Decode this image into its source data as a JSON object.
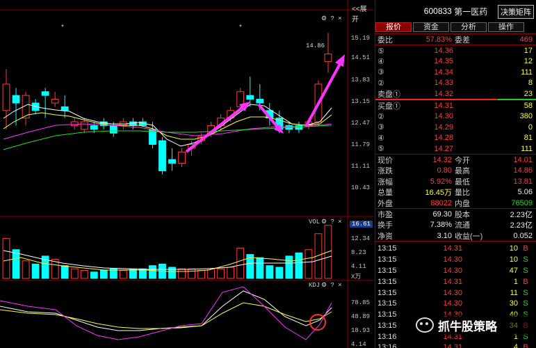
{
  "chart": {
    "toggle_label": "<<展开",
    "price_axis": [
      "15.19",
      "14.51",
      "13.83",
      "13.15",
      "12.47",
      "11.79",
      "11.11",
      "10.43"
    ],
    "high_marker": "14.86",
    "vol_label": "VOL",
    "vol_current": "16.61",
    "vol_axis": [
      "12.34",
      "8.23",
      "4.11"
    ],
    "vol_unit": "X万",
    "kdj_label": "KDJ",
    "kdj_axis": [
      "78.85",
      "48.89",
      "18.93"
    ],
    "kdj_current": "4.14",
    "colors": {
      "up": "#ff3b3b",
      "down": "#00ffff",
      "arrow": "#ff33ff",
      "circle": "#ff3030"
    }
  },
  "chart_data": {
    "type": "candlestick",
    "price_ylim": [
      10.1,
      15.4
    ],
    "candles": [
      [
        12.8,
        13.5,
        12.3,
        13.9
      ],
      [
        13.2,
        13.0,
        12.4,
        13.4
      ],
      [
        12.6,
        13.2,
        12.4,
        13.3
      ],
      [
        13.0,
        12.8,
        12.7,
        13.1
      ],
      [
        13.3,
        13.2,
        12.6,
        13.4
      ],
      [
        13.0,
        13.1,
        12.9,
        13.3
      ],
      [
        12.9,
        12.8,
        12.6,
        13.2
      ],
      [
        12.4,
        12.5,
        12.3,
        12.6
      ],
      [
        12.3,
        12.5,
        12.2,
        12.6
      ],
      [
        12.4,
        12.3,
        12.2,
        12.5
      ],
      [
        12.5,
        12.4,
        12.3,
        12.6
      ],
      [
        12.4,
        12.2,
        12.1,
        12.5
      ],
      [
        12.4,
        12.5,
        12.3,
        12.6
      ],
      [
        12.5,
        12.4,
        12.3,
        12.6
      ],
      [
        12.5,
        12.4,
        12.4,
        12.6
      ],
      [
        12.3,
        11.9,
        11.8,
        12.5
      ],
      [
        12.0,
        11.2,
        11.1,
        12.1
      ],
      [
        11.5,
        11.4,
        11.2,
        11.8
      ],
      [
        11.4,
        11.7,
        11.3,
        11.8
      ],
      [
        11.8,
        11.9,
        11.6,
        12.0
      ],
      [
        12.0,
        12.1,
        11.9,
        12.2
      ],
      [
        12.2,
        12.4,
        12.1,
        12.5
      ],
      [
        12.4,
        12.6,
        12.3,
        12.7
      ],
      [
        12.6,
        12.8,
        12.5,
        12.9
      ],
      [
        12.9,
        13.3,
        12.8,
        13.4
      ],
      [
        13.2,
        13.1,
        12.9,
        13.7
      ],
      [
        13.1,
        13.0,
        12.8,
        13.5
      ],
      [
        12.8,
        12.6,
        12.4,
        13.0
      ],
      [
        12.6,
        12.3,
        12.2,
        12.8
      ],
      [
        12.4,
        12.3,
        12.2,
        12.5
      ],
      [
        12.4,
        12.3,
        12.2,
        12.5
      ],
      [
        12.4,
        12.5,
        12.3,
        12.6
      ],
      [
        12.5,
        13.5,
        12.4,
        13.6
      ],
      [
        14.1,
        14.3,
        13.8,
        14.86
      ]
    ],
    "volumes": [
      12.5,
      9.0,
      5.5,
      4.5,
      7.0,
      6.0,
      4.0,
      3.0,
      2.5,
      2.0,
      2.5,
      3.0,
      2.5,
      3.0,
      3.0,
      4.0,
      4.5,
      3.5,
      3.0,
      3.0,
      2.5,
      3.0,
      3.0,
      3.5,
      9.5,
      7.5,
      6.5,
      4.0,
      3.5,
      7.0,
      8.0,
      9.0,
      14.0,
      16.61
    ],
    "vol_ylim": [
      0,
      17
    ]
  },
  "panel": {
    "code": "600833",
    "name": "第一医药",
    "decision_button": "决策矩阵",
    "tabs": [
      "报价",
      "资金",
      "分析",
      "操作"
    ],
    "weibi_label": "委比",
    "weibi_value": "57.83%",
    "weicha_label": "委差",
    "weicha_value": "469",
    "asks": [
      {
        "label": "⑤",
        "price": "14.36",
        "vol": "17"
      },
      {
        "label": "④",
        "price": "14.35",
        "vol": "12"
      },
      {
        "label": "③",
        "price": "14.34",
        "vol": "111"
      },
      {
        "label": "②",
        "price": "14.33",
        "vol": "8"
      },
      {
        "label": "卖盘①",
        "price": "14.32",
        "vol": "23"
      }
    ],
    "bids": [
      {
        "label": "买盘①",
        "price": "14.31",
        "vol": "58"
      },
      {
        "label": "②",
        "price": "14.30",
        "vol": "380"
      },
      {
        "label": "③",
        "price": "14.29",
        "vol": "0"
      },
      {
        "label": "④",
        "price": "14.28",
        "vol": "81"
      },
      {
        "label": "⑤",
        "price": "14.27",
        "vol": "111"
      }
    ],
    "stats": [
      {
        "l1": "现价",
        "v1": "14.32",
        "c1": "red",
        "l2": "今开",
        "v2": "14.01",
        "c2": "red"
      },
      {
        "l1": "涨跌",
        "v1": "0.80",
        "c1": "red",
        "l2": "最高",
        "v2": "14.86",
        "c2": "red"
      },
      {
        "l1": "涨幅",
        "v1": "5.92%",
        "c1": "red",
        "l2": "最低",
        "v2": "13.81",
        "c2": "red"
      },
      {
        "l1": "总量",
        "v1": "16.45万",
        "c1": "yellow",
        "l2": "量比",
        "v2": "5.06",
        "c2": "white"
      },
      {
        "l1": "外盘",
        "v1": "88022",
        "c1": "red",
        "l2": "内盘",
        "v2": "76509",
        "c2": "green"
      }
    ],
    "stats2": [
      {
        "l1": "市盈",
        "v1": "69.30",
        "l2": "股本",
        "v2": "2.23亿"
      },
      {
        "l1": "换手",
        "v1": "7.38%",
        "l2": "流通",
        "v2": "2.23亿"
      },
      {
        "l1": "净资",
        "v1": "3.10",
        "l2": "收益(一)",
        "v2": "0.052"
      }
    ],
    "trades": [
      {
        "t": "13:15",
        "p": "14.31",
        "v": "10",
        "d": "B"
      },
      {
        "t": "13:15",
        "p": "14.30",
        "v": "10",
        "d": "S"
      },
      {
        "t": "13:15",
        "p": "14.30",
        "v": "47",
        "d": "S"
      },
      {
        "t": "13:15",
        "p": "14.31",
        "v": "1",
        "d": "B"
      },
      {
        "t": "13:15",
        "p": "14.30",
        "v": "11",
        "d": "S"
      },
      {
        "t": "13:15",
        "p": "14.30",
        "v": "30",
        "d": "S"
      },
      {
        "t": "13:15",
        "p": "14.30",
        "v": "40",
        "d": "S"
      },
      {
        "t": "13:15",
        "p": "14.30",
        "v": "34",
        "d": "B"
      },
      {
        "t": "13:16",
        "p": "14.31",
        "v": "1",
        "d": "S"
      },
      {
        "t": "13:16",
        "p": "14.31",
        "v": "4",
        "d": "B"
      }
    ],
    "watermark": "抓牛股策略"
  }
}
